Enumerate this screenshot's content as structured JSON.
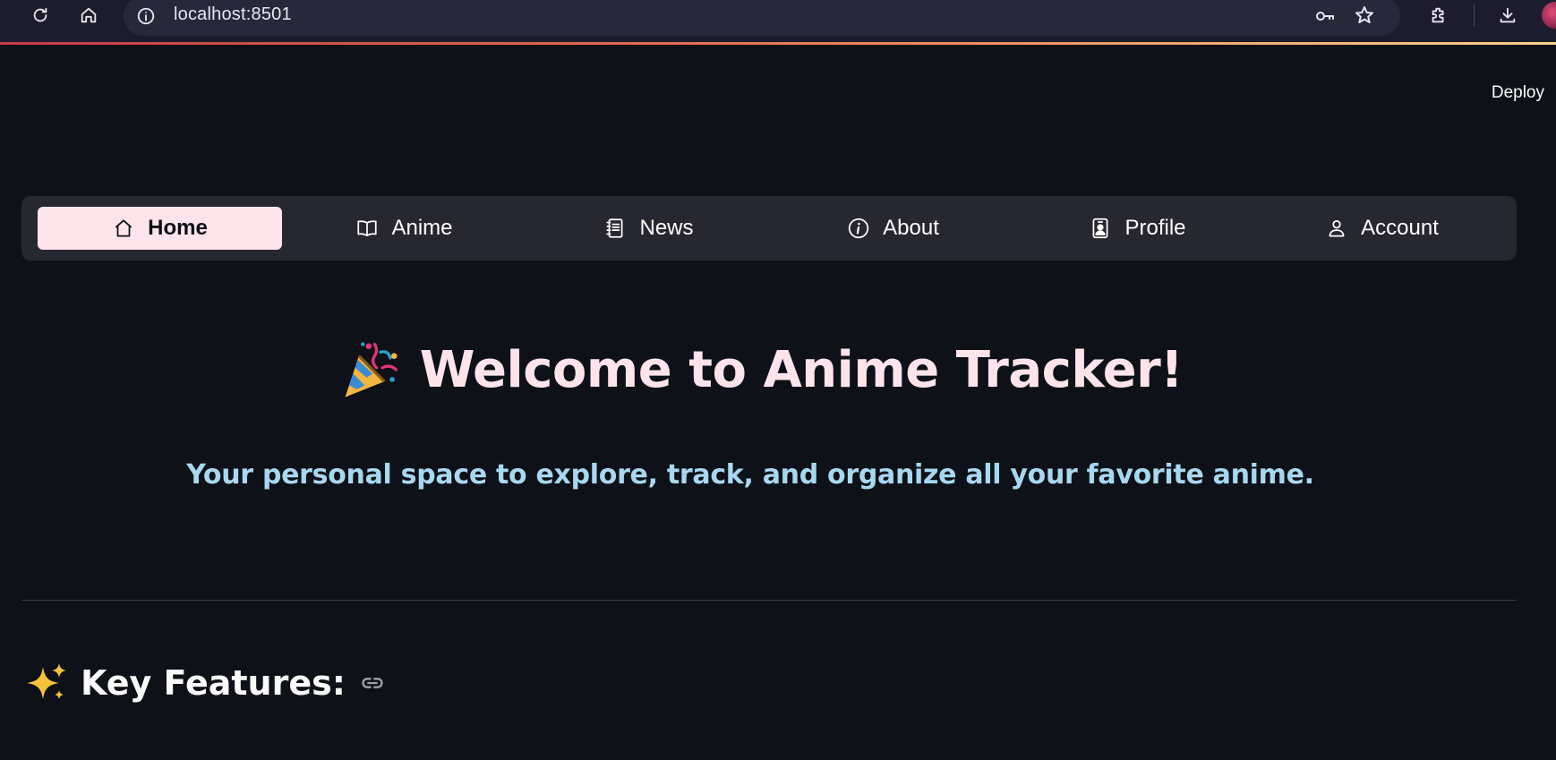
{
  "browser": {
    "url": "localhost:8501",
    "icons": [
      "reload-icon",
      "home-icon",
      "site-info-icon",
      "password-key-icon",
      "bookmark-star-icon",
      "extensions-icon",
      "downloads-icon",
      "profile-avatar"
    ]
  },
  "header": {
    "deploy_label": "Deploy"
  },
  "nav": {
    "items": [
      {
        "label": "Home",
        "icon": "home-icon",
        "active": true
      },
      {
        "label": "Anime",
        "icon": "book-icon",
        "active": false
      },
      {
        "label": "News",
        "icon": "journal-icon",
        "active": false
      },
      {
        "label": "About",
        "icon": "info-icon",
        "active": false
      },
      {
        "label": "Profile",
        "icon": "person-badge-icon",
        "active": false
      },
      {
        "label": "Account",
        "icon": "person-icon",
        "active": false
      }
    ]
  },
  "hero": {
    "emoji": "party-popper-icon",
    "title": "Welcome to Anime Tracker!",
    "subtitle": "Your personal space to explore, track, and organize all your favorite anime."
  },
  "features": {
    "emoji": "sparkles-icon",
    "heading": "Key Features:",
    "anchor_icon": "link-icon"
  },
  "colors": {
    "background": "#0e1117",
    "nav_background": "#262730",
    "nav_active_background": "#fde4ea",
    "title_color": "#fde4ea",
    "subtitle_color": "#a8d8f0",
    "browser_bar": "#1d1c2d"
  }
}
